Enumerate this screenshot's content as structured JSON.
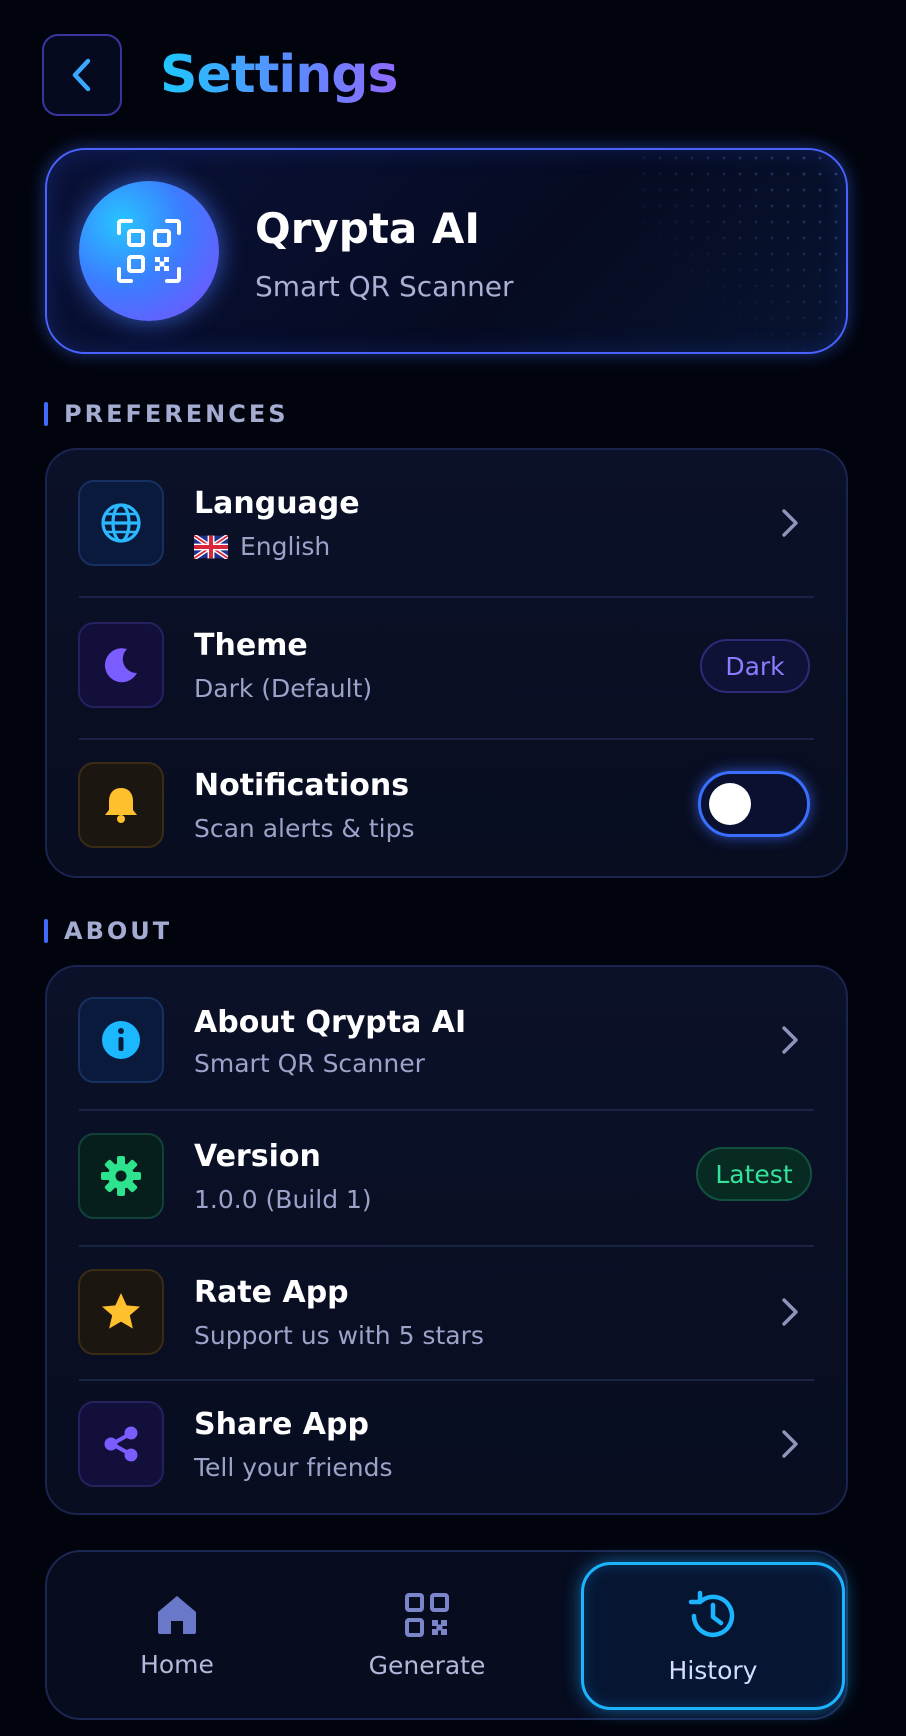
{
  "header": {
    "title": "Settings"
  },
  "hero": {
    "app_name": "Qrypta AI",
    "tagline": "Smart QR Scanner"
  },
  "preferences": {
    "heading": "PREFERENCES",
    "language": {
      "title": "Language",
      "value": "English",
      "flag": "uk-flag"
    },
    "theme": {
      "title": "Theme",
      "value": "Dark (Default)",
      "badge": "Dark"
    },
    "notifications": {
      "title": "Notifications",
      "subtitle": "Scan alerts & tips",
      "enabled": false
    }
  },
  "about": {
    "heading": "ABOUT",
    "about_app": {
      "title": "About Qrypta AI",
      "subtitle": "Smart QR Scanner"
    },
    "version": {
      "title": "Version",
      "subtitle": "1.0.0 (Build 1)",
      "badge": "Latest"
    },
    "rate": {
      "title": "Rate App",
      "subtitle": "Support us with 5 stars"
    },
    "share": {
      "title": "Share App",
      "subtitle": "Tell your friends"
    }
  },
  "nav": {
    "items": [
      {
        "label": "Home",
        "icon": "home-icon",
        "active": false
      },
      {
        "label": "Generate",
        "icon": "qr-icon",
        "active": false
      },
      {
        "label": "History",
        "icon": "history-icon",
        "active": true
      }
    ]
  },
  "colors": {
    "background": "#02040d",
    "accent_blue": "#1cb4ff",
    "accent_purple": "#8d7cff",
    "accent_green": "#34e29a",
    "accent_yellow": "#ffc02e"
  }
}
